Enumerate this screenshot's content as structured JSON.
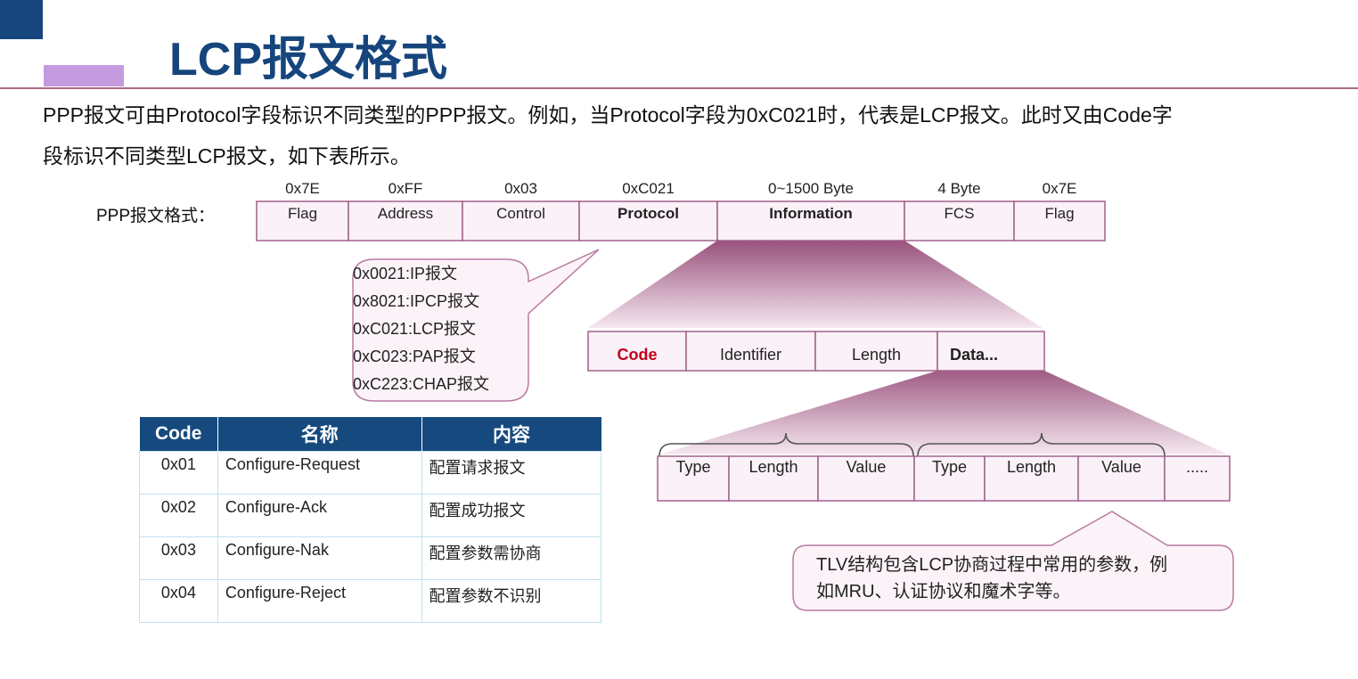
{
  "slide": {
    "title": "LCP报文格式",
    "intro_line1": "PPP报文可由Protocol字段标识不同类型的PPP报文。例如，当Protocol字段为0xC021时，代表是LCP报文。此时又由Code字",
    "intro_line2": "段标识不同类型LCP报文，如下表所示。"
  },
  "ppp_frame": {
    "label": "PPP报文格式：",
    "fields": [
      {
        "value": "0x7E",
        "name": "Flag",
        "bold": false
      },
      {
        "value": "0xFF",
        "name": "Address",
        "bold": false
      },
      {
        "value": "0x03",
        "name": "Control",
        "bold": false
      },
      {
        "value": "0xC021",
        "name": "Protocol",
        "bold": true
      },
      {
        "value": "0~1500 Byte",
        "name": "Information",
        "bold": true
      },
      {
        "value": "4 Byte",
        "name": "FCS",
        "bold": false
      },
      {
        "value": "0x7E",
        "name": "Flag",
        "bold": false
      }
    ]
  },
  "protocol_callout": [
    "0x0021:IP报文",
    "0x8021:IPCP报文",
    "0xC021:LCP报文",
    "0xC023:PAP报文",
    "0xC223:CHAP报文"
  ],
  "lcp_packet": {
    "fields": [
      "Code",
      "Identifier",
      "Length",
      "Data..."
    ]
  },
  "tlv_row": {
    "fields": [
      "Type",
      "Length",
      "Value",
      "Type",
      "Length",
      "Value",
      "....."
    ]
  },
  "tlv_callout": {
    "line1": "TLV结构包含LCP协商过程中常用的参数，例",
    "line2": "如MRU、认证协议和魔术字等。"
  },
  "code_table": {
    "headers": [
      "Code",
      "名称",
      "内容"
    ],
    "rows": [
      [
        "0x01",
        "Configure-Request",
        "配置请求报文"
      ],
      [
        "0x02",
        "Configure-Ack",
        "配置成功报文"
      ],
      [
        "0x03",
        "Configure-Nak",
        "配置参数需协商"
      ],
      [
        "0x04",
        "Configure-Reject",
        "配置参数不识别"
      ]
    ]
  },
  "colors": {
    "title": "#15457c",
    "header_bg": "#164a7f",
    "frame_border": "#a0628a",
    "frame_fill": "#fbf1f8",
    "code_red": "#c0001a"
  }
}
